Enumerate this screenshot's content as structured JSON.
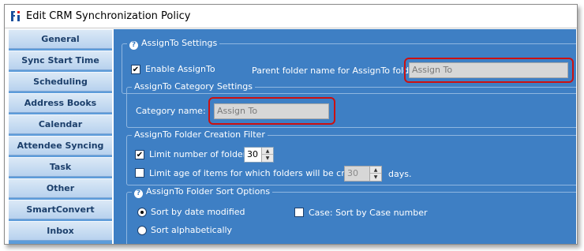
{
  "window": {
    "title": "Edit CRM Synchronization Policy"
  },
  "sidebar": {
    "items": [
      {
        "label": "General"
      },
      {
        "label": "Sync Start Time"
      },
      {
        "label": "Scheduling"
      },
      {
        "label": "Address Books"
      },
      {
        "label": "Calendar"
      },
      {
        "label": "Attendee Syncing"
      },
      {
        "label": "Task"
      },
      {
        "label": "Other"
      },
      {
        "label": "SmartConvert"
      },
      {
        "label": "Inbox"
      }
    ]
  },
  "assignto": {
    "legend": "AssignTo Settings",
    "enable_label": "Enable AssignTo",
    "enable_checked": true,
    "parent_folder_label": "Parent folder name for AssignTo folders",
    "parent_folder_value": "Assign To"
  },
  "category": {
    "legend": "AssignTo Category Settings",
    "name_label": "Category name:",
    "name_value": "Assign To"
  },
  "folder_filter": {
    "legend": "AssignTo Folder Creation Filter",
    "limit_folders_label": "Limit number of folders:",
    "limit_folders_checked": true,
    "limit_folders_value": "30",
    "limit_age_label": "Limit age of items for which folders will be created:",
    "limit_age_checked": false,
    "limit_age_value": "30",
    "days_label": "days."
  },
  "sort": {
    "legend": "AssignTo Folder Sort Options",
    "by_date_label": "Sort by date modified",
    "by_date_selected": true,
    "alpha_label": "Sort alphabetically",
    "alpha_selected": false,
    "case_label": "Case: Sort by Case number",
    "case_checked": false
  },
  "colors": {
    "sidebar_bg": "#5d9cda",
    "content_bg": "#3e7fc4",
    "highlight": "#cc1010"
  }
}
